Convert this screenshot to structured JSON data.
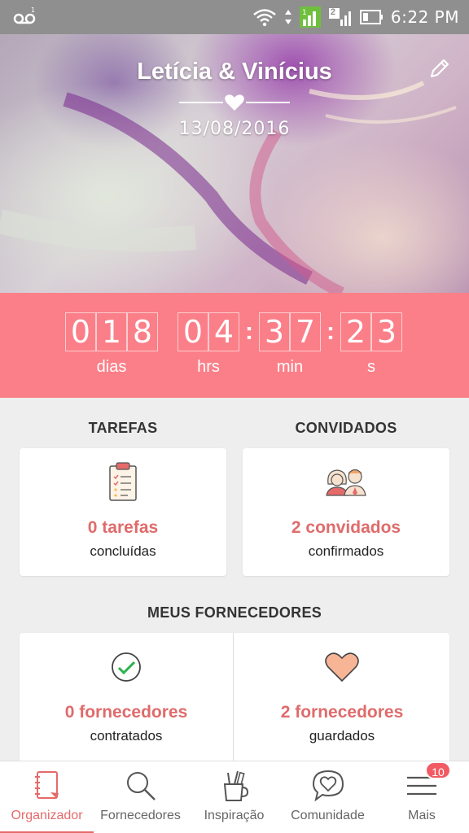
{
  "status_bar": {
    "time": "6:22 PM",
    "icons": [
      "voicemail-icon",
      "wifi-icon",
      "data-arrows-icon",
      "signal-1-icon",
      "signal-2-icon",
      "battery-icon"
    ],
    "sim_badge": "2"
  },
  "hero": {
    "couple_name": "Letícia & Vinícius",
    "date": "13/08/2016",
    "edit_icon": "pencil-icon",
    "divider_icon": "heart-icon"
  },
  "countdown": {
    "days": [
      "0",
      "1",
      "8"
    ],
    "hours": [
      "0",
      "4"
    ],
    "minutes": [
      "3",
      "7"
    ],
    "seconds": [
      "2",
      "3"
    ],
    "labels": {
      "days": "dias",
      "hours": "hrs",
      "minutes": "min",
      "seconds": "s"
    },
    "color": "#fb7f88"
  },
  "tasks": {
    "title": "TAREFAS",
    "main": "0 tarefas",
    "sub": "concluídas",
    "icon": "clipboard-checklist-icon"
  },
  "guests": {
    "title": "CONVIDADOS",
    "main": "2 convidados",
    "sub": "confirmados",
    "icon": "couple-avatars-icon"
  },
  "vendors": {
    "title": "MEUS FORNECEDORES",
    "hired": {
      "main": "0 fornecedores",
      "sub": "contratados",
      "icon": "check-circle-icon"
    },
    "saved": {
      "main": "2 fornecedores",
      "sub": "guardados",
      "icon": "heart-icon"
    }
  },
  "bottom_nav": {
    "items": [
      {
        "label": "Organizador",
        "icon": "notebook-icon",
        "active": true
      },
      {
        "label": "Fornecedores",
        "icon": "search-icon",
        "active": false
      },
      {
        "label": "Inspiração",
        "icon": "pencil-cup-icon",
        "active": false
      },
      {
        "label": "Comunidade",
        "icon": "heart-chat-icon",
        "active": false
      },
      {
        "label": "Mais",
        "icon": "menu-icon",
        "active": false,
        "badge": "10"
      }
    ]
  },
  "colors": {
    "accent": "#e56a6a",
    "countdown_bg": "#fb7f88",
    "badge": "#f25b63"
  }
}
